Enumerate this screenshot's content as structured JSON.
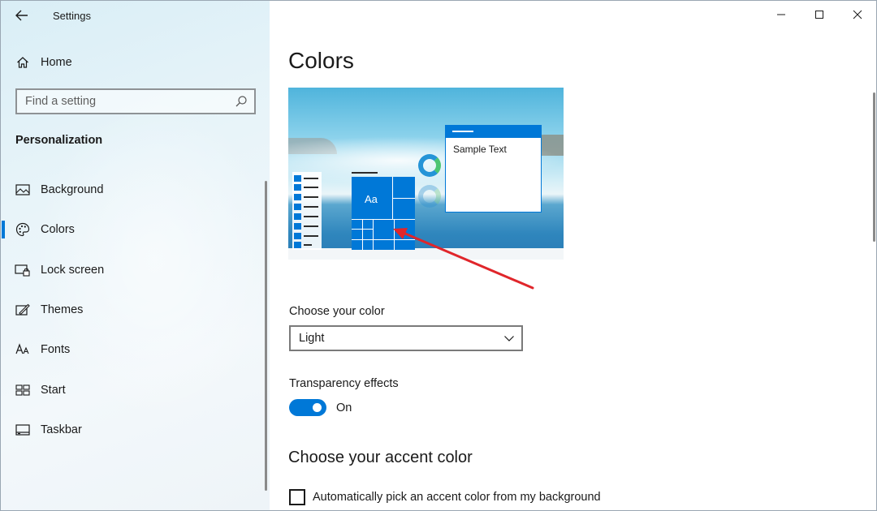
{
  "window": {
    "title": "Settings"
  },
  "sidebar": {
    "home_label": "Home",
    "search_placeholder": "Find a setting",
    "section_heading": "Personalization",
    "items": [
      {
        "label": "Background",
        "icon": "picture-icon",
        "selected": false
      },
      {
        "label": "Colors",
        "icon": "palette-icon",
        "selected": true
      },
      {
        "label": "Lock screen",
        "icon": "lock-screen-icon",
        "selected": false
      },
      {
        "label": "Themes",
        "icon": "brush-icon",
        "selected": false
      },
      {
        "label": "Fonts",
        "icon": "font-icon",
        "selected": false
      },
      {
        "label": "Start",
        "icon": "start-grid-icon",
        "selected": false
      },
      {
        "label": "Taskbar",
        "icon": "taskbar-icon",
        "selected": false
      }
    ]
  },
  "main": {
    "page_title": "Colors",
    "preview": {
      "tile_text": "Aa",
      "sample_text": "Sample Text"
    },
    "choose_color": {
      "label": "Choose your color",
      "value": "Light"
    },
    "transparency": {
      "label": "Transparency effects",
      "state": "On",
      "enabled": true
    },
    "accent": {
      "heading": "Choose your accent color",
      "auto_pick_label": "Automatically pick an accent color from my background",
      "auto_pick_checked": false
    }
  },
  "colors": {
    "accent": "#0078d7",
    "annotation_arrow": "#e0262b"
  }
}
